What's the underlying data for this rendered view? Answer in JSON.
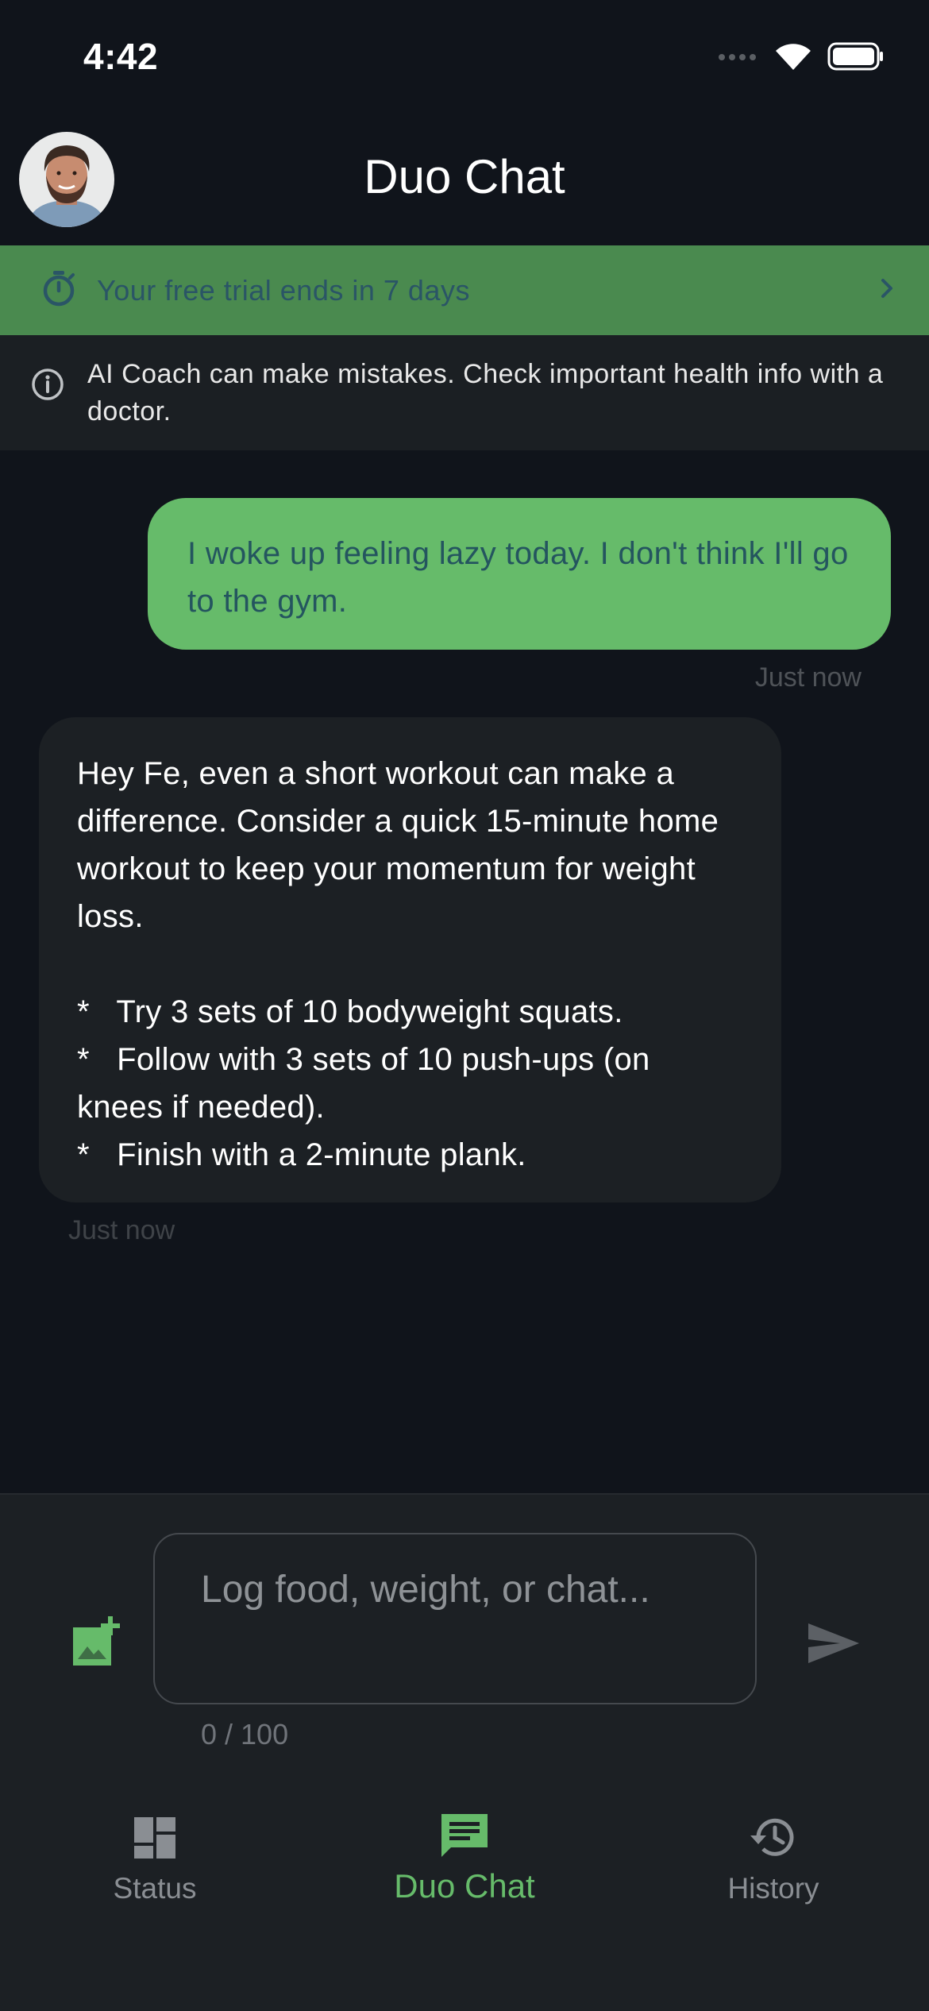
{
  "status_bar": {
    "time": "4:42"
  },
  "header": {
    "title": "Duo Chat"
  },
  "trial_banner": {
    "text": "Your free trial ends in 7 days"
  },
  "disclaimer": {
    "text": "AI Coach can make mistakes. Check important health info with a doctor."
  },
  "messages": [
    {
      "sender": "user",
      "text": "I woke up feeling lazy today. I don't think I'll go to the gym.",
      "time": "Just now"
    },
    {
      "sender": "coach",
      "text": "Hey Fe, even a short workout can make a difference. Consider a quick 15-minute home workout to keep your momentum for weight loss.\n\n*   Try 3 sets of 10 bodyweight squats.\n*   Follow with 3 sets of 10 push-ups (on knees if needed).\n*   Finish with a 2-minute plank.",
      "time": "Just now"
    }
  ],
  "composer": {
    "placeholder": "Log food, weight, or chat...",
    "counter": "0 / 100"
  },
  "nav": {
    "items": [
      {
        "label": "Status",
        "icon": "dashboard-icon",
        "active": false
      },
      {
        "label": "Duo Chat",
        "icon": "chat-icon",
        "active": true
      },
      {
        "label": "History",
        "icon": "history-icon",
        "active": false
      }
    ]
  },
  "colors": {
    "background": "#10141b",
    "accent_green": "#66bb6a",
    "banner_green": "#4a8a4f",
    "surface": "#1c2024"
  }
}
